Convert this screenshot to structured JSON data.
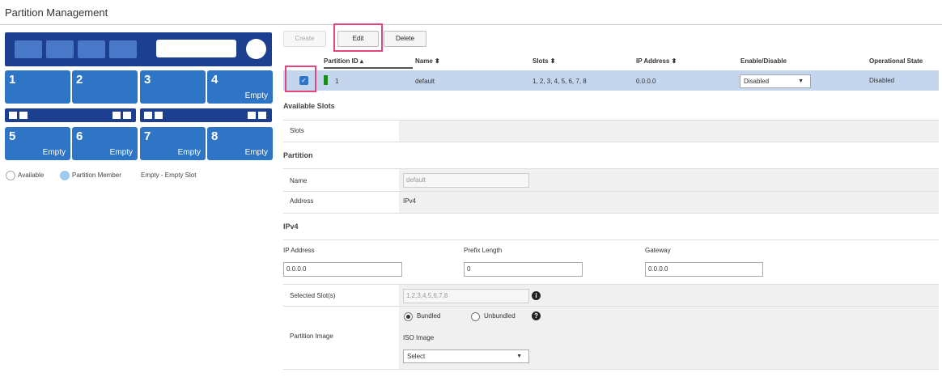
{
  "page": {
    "title": "Partition Management"
  },
  "chassis": {
    "slots": [
      {
        "number": "1",
        "state": ""
      },
      {
        "number": "2",
        "state": ""
      },
      {
        "number": "3",
        "state": ""
      },
      {
        "number": "4",
        "state": "Empty"
      },
      {
        "number": "5",
        "state": "Empty"
      },
      {
        "number": "6",
        "state": "Empty"
      },
      {
        "number": "7",
        "state": "Empty"
      },
      {
        "number": "8",
        "state": "Empty"
      }
    ],
    "legend": {
      "available": "Available",
      "member": "Partition Member",
      "empty": "Empty - Empty Slot"
    },
    "colors": {
      "chassis": "#1d3f8f",
      "slot": "#2e75c6",
      "member_dot": "#9ccbef"
    }
  },
  "toolbar": {
    "create": "Create",
    "edit": "Edit",
    "delete": "Delete"
  },
  "table": {
    "headers": {
      "partition_id": "Partition ID ▴",
      "name": "Name ⬍",
      "slots": "Slots ⬍",
      "ip": "IP Address ⬍",
      "enable": "Enable/Disable",
      "op_state": "Operational State"
    },
    "row": {
      "id": "1",
      "name": "default",
      "slots": "1, 2, 3, 4, 5, 6, 7, 8",
      "ip": "0.0.0.0",
      "enable": "Disabled",
      "op_state": "Disabled",
      "status_color": "#1a8a1a"
    }
  },
  "available_slots": {
    "heading": "Available Slots",
    "label": "Slots"
  },
  "partition": {
    "heading": "Partition",
    "name_label": "Name",
    "name_value": "default",
    "address_label": "Address",
    "address_value": "IPv4"
  },
  "ipv4": {
    "heading": "IPv4",
    "ip_label": "IP Address",
    "ip_value": "0.0.0.0",
    "prefix_label": "Prefix Length",
    "prefix_value": "0",
    "gateway_label": "Gateway",
    "gateway_value": "0.0.0.0"
  },
  "selected": {
    "label": "Selected Slot(s)",
    "value": "1,2,3,4,5,6,7,8"
  },
  "image": {
    "label": "Partition Image",
    "bundled": "Bundled",
    "unbundled": "Unbundled",
    "iso_label": "ISO Image",
    "iso_value": "Select"
  }
}
